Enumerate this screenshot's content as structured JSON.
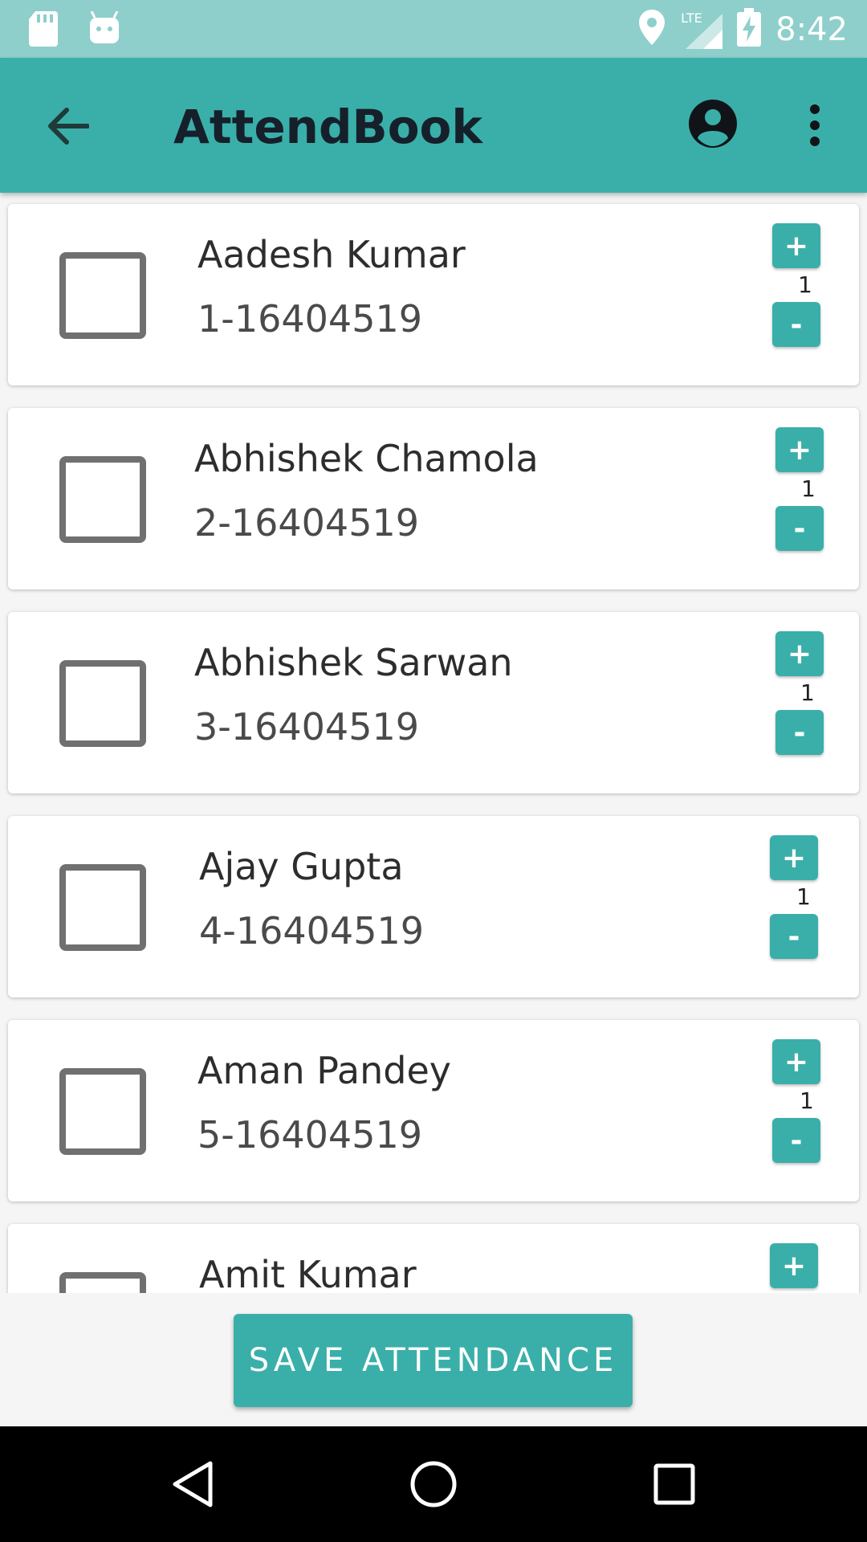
{
  "status_bar": {
    "time": "8:42",
    "network": "LTE"
  },
  "app_bar": {
    "title": "AttendBook"
  },
  "students": [
    {
      "name": "Aadesh Kumar",
      "roll": "1-16404519",
      "count": "1",
      "checked": false
    },
    {
      "name": "Abhishek Chamola",
      "roll": "2-16404519",
      "count": "1",
      "checked": false
    },
    {
      "name": "Abhishek Sarwan",
      "roll": "3-16404519",
      "count": "1",
      "checked": false
    },
    {
      "name": "Ajay Gupta",
      "roll": "4-16404519",
      "count": "1",
      "checked": false
    },
    {
      "name": "Aman Pandey",
      "roll": "5-16404519",
      "count": "1",
      "checked": false
    },
    {
      "name": "Amit Kumar",
      "roll": "",
      "count": "",
      "checked": false
    }
  ],
  "buttons": {
    "plus": "+",
    "minus": "-",
    "save": "SAVE ATTENDANCE"
  },
  "colors": {
    "accent": "#3aafa9",
    "status_bar": "#8ecfcb",
    "title_text": "#16202a"
  }
}
